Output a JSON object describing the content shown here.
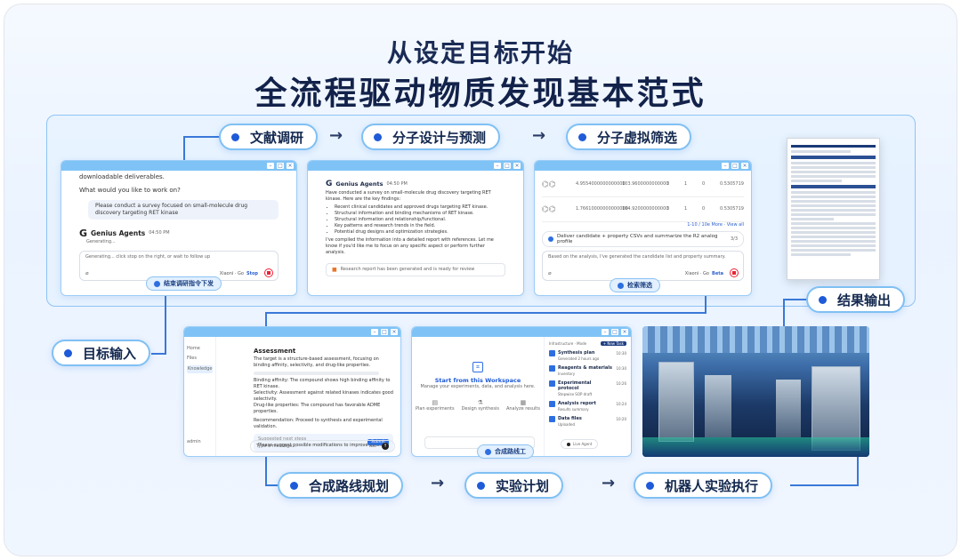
{
  "title": {
    "line1": "从设定目标开始",
    "line2": "全流程驱动物质发现基本范式"
  },
  "steps": {
    "lit": "文献调研",
    "design": "分子设计与预测",
    "screen": "分子虚拟筛选",
    "output": "结果输出",
    "goal": "目标输入",
    "route": "合成路线规划",
    "plan": "实验计划",
    "robot": "机器人实验执行"
  },
  "win1": {
    "l1": "downloadable deliverables.",
    "l2": "What would you like to work on?",
    "bubble": "Please conduct a survey focused on small-molecule drug discovery targeting RET kinase",
    "agent": "Genius Agents",
    "time": "04:50 PM",
    "status": "Generating...",
    "input_placeholder": "Generating... click stop on the right, or wait to follow up",
    "model": "Xiaoni · Go",
    "stop": "Stop",
    "button": "结束调研指令下发"
  },
  "win2": {
    "agent": "Genius Agents",
    "time": "04:50 PM",
    "intro": "Have conducted a survey on small-molecule drug discovery targeting RET kinase. Here are the key findings:",
    "bullets": [
      "Recent clinical candidates and approved drugs targeting RET kinase.",
      "Structural information and binding mechanisms of RET kinase.",
      "Structural information and relationship/functional.",
      "Key patterns and research trends in the field.",
      "Potential drug designs and optimization strategies."
    ],
    "outro": "I've compiled the information into a detailed report with references. Let me know if you'd like me to focus on any specific aspect or perform further analysis.",
    "file": "Research report has been generated and is ready for review"
  },
  "win3": {
    "rows": [
      [
        "4.9554000000000000",
        "103.9600000000000",
        "3",
        "1",
        "0",
        "0.5305719"
      ],
      [
        "1.76610000000000000",
        "104.9200000000000",
        "3",
        "1",
        "0",
        "0.5305719"
      ]
    ],
    "pager": "1-10 / 10e More · View all",
    "prompt": "Deliver candidate + property CSVs and summarize the R2 analog profile",
    "prompt_count": "3/3",
    "reply": "Based on the analysis, I've generated the candidate list and property summary.",
    "model": "Xiaoni · Go",
    "send": "Beta",
    "button": "检索筛选"
  },
  "win4": {
    "nav": [
      "Home",
      "Files",
      "Knowledge"
    ],
    "user": "admin",
    "heading": "Assessment",
    "para": "The target is a structure-based assessment, focusing on binding affinity, selectivity, and drug-like properties.",
    "items": [
      "Binding affinity: The compound shows high binding affinity to RET kinase.",
      "Selectivity: Assessment against related kinases indicates good selectivity.",
      "Drug-like properties: The compound has favorable ADME properties."
    ],
    "rec": "Recommendation: Proceed to synthesis and experimental validation.",
    "suggest_title": "Suggested next steps",
    "suggest": "Please suggest possible modifications to improve potency.",
    "suggest_btn": "Submit",
    "input": "Type a message...",
    "model": "Go"
  },
  "win5": {
    "title": "Start from this Workspace",
    "subtitle": "Manage your experiments, data, and analysis here.",
    "actions": [
      "Plan experiments",
      "Design synthesis",
      "Analyze results"
    ],
    "side_head": "Infrastructure · Mode",
    "side_btn": "+ New Task",
    "side": [
      [
        "Synthesis plan",
        "Generated 2 hours ago",
        "10:30"
      ],
      [
        "Reagents & materials",
        "Inventory",
        "10:30"
      ],
      [
        "Experimental protocol",
        "Stepwise SOP draft",
        "10:26"
      ],
      [
        "Analysis report",
        "Results summary",
        "10:24"
      ],
      [
        "Data files",
        "Uploaded",
        "10:20"
      ]
    ],
    "status": "Live Agent",
    "button": "合成路线工"
  }
}
